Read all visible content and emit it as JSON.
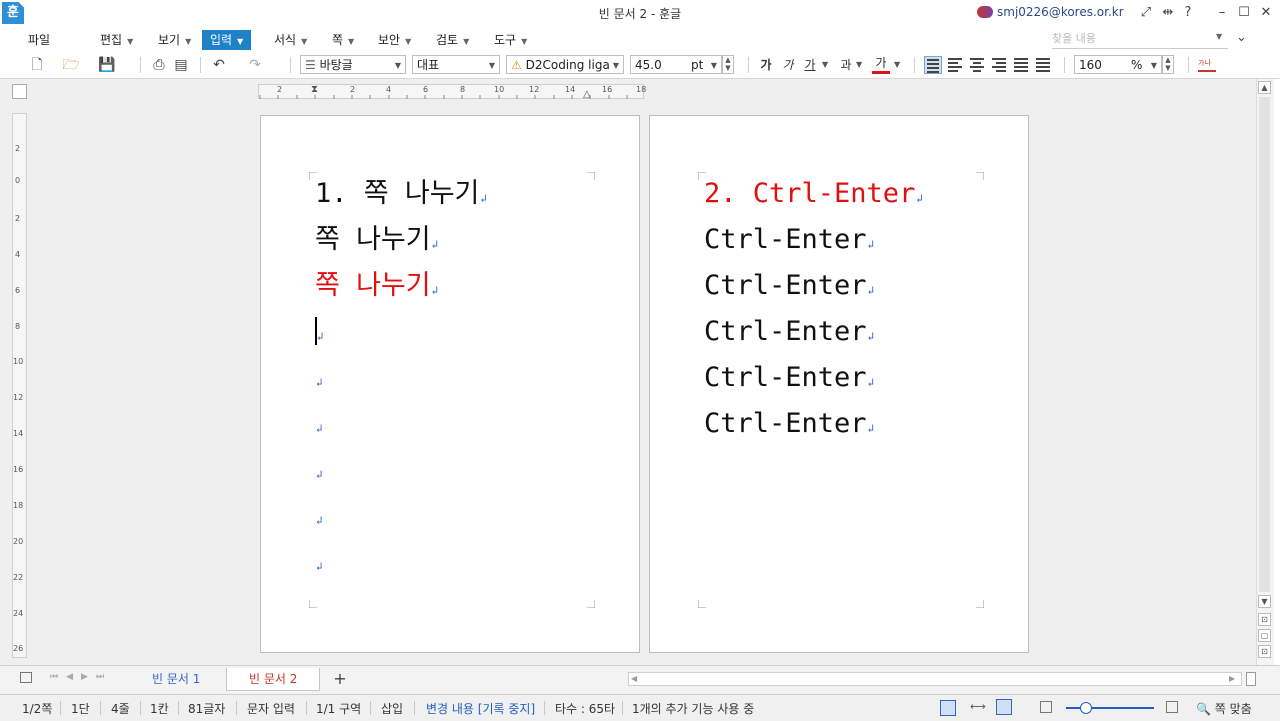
{
  "window": {
    "app_icon": "hancom-icon",
    "app_icon_glyph": "훈",
    "title": "빈 문서 2 - 훈글",
    "account": "smj0226@kores.or.kr",
    "account_icon": "account-cloud-icon"
  },
  "menu": {
    "items": [
      "파일",
      "편집",
      "보기",
      "입력",
      "서식",
      "쪽",
      "보안",
      "검토",
      "도구"
    ],
    "active": "입력",
    "search_placeholder": "찾을 내용"
  },
  "toolbar": {
    "style": "바탕글",
    "font_group": "대표",
    "font_name": "D2Coding liga",
    "font_size": "45.0",
    "font_unit": "pt",
    "bold": "가",
    "italic": "가",
    "underline": "가",
    "strike": "과",
    "color_char": "가",
    "zoom": "160",
    "zoom_unit": "%",
    "highlight_color": "#e01010"
  },
  "ruler": {
    "h_ticks": [
      "2",
      "2",
      "4",
      "6",
      "8",
      "10",
      "12",
      "14",
      "16",
      "18"
    ],
    "v_ticks": [
      "2",
      "0",
      "2",
      "4",
      "6",
      "8",
      "10",
      "12",
      "14",
      "16",
      "18",
      "20",
      "22",
      "24",
      "26"
    ]
  },
  "document": {
    "page1": {
      "lines": [
        {
          "text": "1. 쪽 나누기",
          "color": "#111111"
        },
        {
          "text": "쪽 나누기",
          "color": "#111111"
        },
        {
          "text": "쪽 나누기",
          "color": "#e01010"
        }
      ],
      "empty_paragraphs": 6
    },
    "page2": {
      "lines": [
        {
          "text": "2. Ctrl-Enter",
          "color": "#e01010"
        },
        {
          "text": "Ctrl-Enter",
          "color": "#111111"
        },
        {
          "text": "Ctrl-Enter",
          "color": "#111111"
        },
        {
          "text": "Ctrl-Enter",
          "color": "#111111"
        },
        {
          "text": "Ctrl-Enter",
          "color": "#111111"
        },
        {
          "text": "Ctrl-Enter",
          "color": "#111111"
        }
      ]
    },
    "paragraph_mark": "↲"
  },
  "tabs": {
    "items": [
      "빈 문서 1",
      "빈 문서 2"
    ],
    "active": "빈 문서 2",
    "add": "+"
  },
  "status": {
    "page": "1/2쪽",
    "column": "1단",
    "line": "4줄",
    "col": "1칸",
    "chars": "81글자",
    "input_mode": "문자 입력",
    "section": "1/1 구역",
    "insert": "삽입",
    "track_changes": "변경 내용 [기록 중지]",
    "typing": "타수 : 65타",
    "addons": "1개의 추가 기능 사용 중",
    "fit": "쪽 맞춤"
  }
}
